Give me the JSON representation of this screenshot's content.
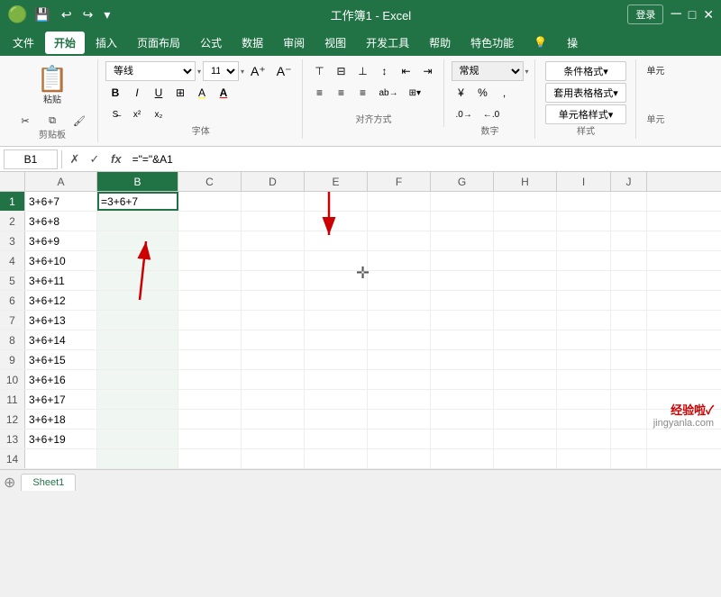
{
  "titleBar": {
    "title": "工作簿1 - Excel",
    "loginBtn": "登录",
    "quickAccess": [
      "💾",
      "↩",
      "↪",
      "▾"
    ]
  },
  "menuBar": {
    "items": [
      "文件",
      "开始",
      "插入",
      "页面布局",
      "公式",
      "数据",
      "审阅",
      "视图",
      "开发工具",
      "帮助",
      "特色功能",
      "💡",
      "操"
    ]
  },
  "ribbon": {
    "groups": [
      {
        "label": "剪贴板",
        "items": [
          "粘贴"
        ]
      },
      {
        "label": "字体",
        "fontName": "等线",
        "fontSize": "11",
        "bold": "B",
        "italic": "I",
        "underline": "U"
      },
      {
        "label": "对齐方式"
      },
      {
        "label": "数字",
        "format": "常规"
      },
      {
        "label": "样式",
        "items": [
          "条件格式▾",
          "套用表格格式▾",
          "单元格样式▾"
        ]
      },
      {
        "label": "单元"
      }
    ]
  },
  "formulaBar": {
    "cellRef": "B1",
    "formula": "=\"=\"&A1",
    "cancelBtn": "✗",
    "confirmBtn": "✓",
    "fxLabel": "fx"
  },
  "columns": [
    "A",
    "B",
    "C",
    "D",
    "E",
    "F",
    "G",
    "H",
    "I",
    "J"
  ],
  "rows": [
    {
      "num": 1,
      "a": "3+6+7",
      "b": "=3+6+7"
    },
    {
      "num": 2,
      "a": "3+6+8",
      "b": ""
    },
    {
      "num": 3,
      "a": "3+6+9",
      "b": ""
    },
    {
      "num": 4,
      "a": "3+6+10",
      "b": ""
    },
    {
      "num": 5,
      "a": "3+6+11",
      "b": ""
    },
    {
      "num": 6,
      "a": "3+6+12",
      "b": ""
    },
    {
      "num": 7,
      "a": "3+6+13",
      "b": ""
    },
    {
      "num": 8,
      "a": "3+6+14",
      "b": ""
    },
    {
      "num": 9,
      "a": "3+6+15",
      "b": ""
    },
    {
      "num": 10,
      "a": "3+6+16",
      "b": ""
    },
    {
      "num": 11,
      "a": "3+6+17",
      "b": ""
    },
    {
      "num": 12,
      "a": "3+6+18",
      "b": ""
    },
    {
      "num": 13,
      "a": "3+6+19",
      "b": ""
    },
    {
      "num": 14,
      "a": "",
      "b": ""
    }
  ],
  "sheetTabs": [
    "Sheet1"
  ],
  "watermark": {
    "line1": "经验啦✓",
    "line2": "jingyanla.com"
  },
  "activeCell": "B1",
  "activeCol": "B",
  "activeRow": 1
}
